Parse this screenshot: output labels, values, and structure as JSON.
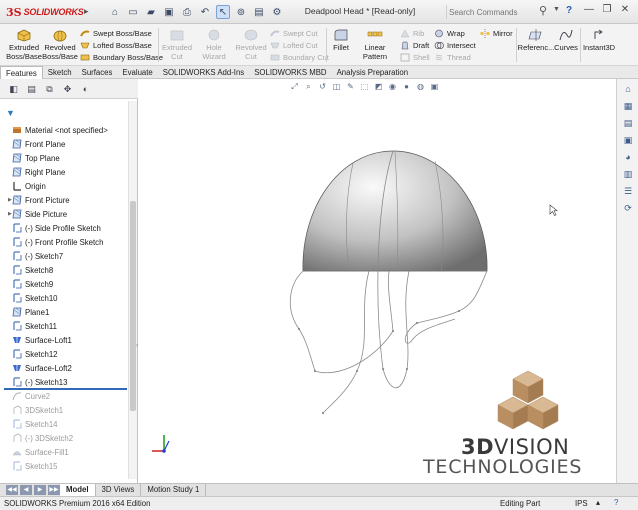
{
  "app": {
    "brand_prefix": "3S",
    "brand_name": "SOLIDWORKS",
    "document_title": "Deadpool Head * [Read-only]",
    "search_placeholder": "Search Commands",
    "help": "?"
  },
  "command_manager": {
    "extruded_boss": "Extruded Boss/Base",
    "revolved_boss": "Revolved Boss/Base",
    "swept_boss": "Swept Boss/Base",
    "lofted_boss": "Lofted Boss/Base",
    "boundary_boss": "Boundary Boss/Base",
    "extruded_cut": "Extruded Cut",
    "hole_wizard": "Hole Wizard",
    "revolved_cut": "Revolved Cut",
    "swept_cut": "Swept Cut",
    "lofted_cut": "Lofted Cut",
    "boundary_cut": "Boundary Cut",
    "fillet": "Fillet",
    "linear_pattern": "Linear Pattern",
    "rib": "Rib",
    "draft": "Draft",
    "shell": "Shell",
    "wrap": "Wrap",
    "intersect": "Intersect",
    "thread": "Thread",
    "mirror": "Mirror",
    "reference": "Referenc...",
    "curves": "Curves",
    "instant3d": "Instant3D"
  },
  "tabs": [
    {
      "label": "Features",
      "active": true
    },
    {
      "label": "Sketch",
      "active": false
    },
    {
      "label": "Surfaces",
      "active": false
    },
    {
      "label": "Evaluate",
      "active": false
    },
    {
      "label": "SOLIDWORKS Add-Ins",
      "active": false
    },
    {
      "label": "SOLIDWORKS MBD",
      "active": false
    },
    {
      "label": "Analysis Preparation",
      "active": false
    }
  ],
  "feature_tree": [
    {
      "label": "Material <not specified>",
      "icon": "material-icon",
      "expand": false,
      "suppressed": false
    },
    {
      "label": "Front Plane",
      "icon": "plane-icon",
      "expand": false,
      "suppressed": false
    },
    {
      "label": "Top Plane",
      "icon": "plane-icon",
      "expand": false,
      "suppressed": false
    },
    {
      "label": "Right Plane",
      "icon": "plane-icon",
      "expand": false,
      "suppressed": false
    },
    {
      "label": "Origin",
      "icon": "origin-icon",
      "expand": false,
      "suppressed": false
    },
    {
      "label": "Front Picture",
      "icon": "plane-icon",
      "expand": true,
      "suppressed": false
    },
    {
      "label": "Side Picture",
      "icon": "plane-icon",
      "expand": true,
      "suppressed": false
    },
    {
      "label": "(-) Side Profile Sketch",
      "icon": "sketch-icon",
      "expand": false,
      "suppressed": false
    },
    {
      "label": "(-) Front Profile Sketch",
      "icon": "sketch-icon",
      "expand": false,
      "suppressed": false
    },
    {
      "label": "(-) Sketch7",
      "icon": "sketch-icon",
      "expand": false,
      "suppressed": false
    },
    {
      "label": "Sketch8",
      "icon": "sketch-icon",
      "expand": false,
      "suppressed": false
    },
    {
      "label": "Sketch9",
      "icon": "sketch-icon",
      "expand": false,
      "suppressed": false
    },
    {
      "label": "Sketch10",
      "icon": "sketch-icon",
      "expand": false,
      "suppressed": false
    },
    {
      "label": "Plane1",
      "icon": "plane-icon",
      "expand": false,
      "suppressed": false
    },
    {
      "label": "Sketch11",
      "icon": "sketch-icon",
      "expand": false,
      "suppressed": false
    },
    {
      "label": "Surface-Loft1",
      "icon": "loft-icon",
      "expand": false,
      "suppressed": false
    },
    {
      "label": "Sketch12",
      "icon": "sketch-icon",
      "expand": false,
      "suppressed": false
    },
    {
      "label": "Surface-Loft2",
      "icon": "loft-icon",
      "expand": false,
      "suppressed": false
    },
    {
      "label": "(-) Sketch13",
      "icon": "sketch-icon",
      "expand": false,
      "suppressed": false
    },
    {
      "label": "Curve2",
      "icon": "curve-icon",
      "expand": false,
      "suppressed": true
    },
    {
      "label": "3DSketch1",
      "icon": "sketch3d-icon",
      "expand": false,
      "suppressed": true
    },
    {
      "label": "Sketch14",
      "icon": "sketch-icon",
      "expand": false,
      "suppressed": true
    },
    {
      "label": "(-) 3DSketch2",
      "icon": "sketch3d-icon",
      "expand": false,
      "suppressed": true
    },
    {
      "label": "Surface-Fill1",
      "icon": "fill-icon",
      "expand": false,
      "suppressed": true
    },
    {
      "label": "Sketch15",
      "icon": "sketch-icon",
      "expand": false,
      "suppressed": true
    }
  ],
  "watermark": {
    "line1_bold": "3D",
    "line1_rest": "VISION",
    "line2": "TECHNOLOGIES"
  },
  "bottom_tabs": [
    {
      "label": "Model",
      "active": true
    },
    {
      "label": "3D Views",
      "active": false
    },
    {
      "label": "Motion Study 1",
      "active": false
    }
  ],
  "status": {
    "edition": "SOLIDWORKS Premium 2016 x64 Edition",
    "mode": "Editing Part",
    "units": "IPS"
  },
  "colors": {
    "brand_red": "#cc1b1b",
    "rollback_blue": "#2f69b8",
    "axis_x": "#d02020",
    "axis_y": "#1a9a1a",
    "axis_z": "#2040d0",
    "watermark_tan": "#c8a27a"
  }
}
